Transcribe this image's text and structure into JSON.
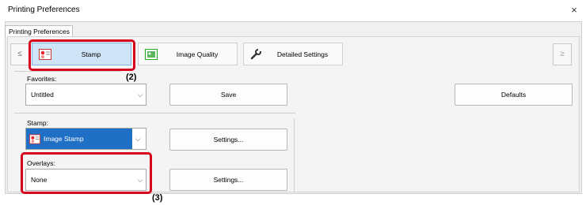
{
  "window": {
    "title": "Printing Preferences",
    "close_glyph": "×"
  },
  "tab": {
    "label": "Printing Preferences"
  },
  "nav": {
    "prev": "≤",
    "next": "≥"
  },
  "top_tabs": [
    {
      "label": "Stamp",
      "icon": "stamp-icon"
    },
    {
      "label": "Image Quality",
      "icon": "image-quality-icon"
    },
    {
      "label": "Detailed Settings",
      "icon": "wrench-icon"
    }
  ],
  "favorites": {
    "label": "Favorites:",
    "value": "Untitled",
    "save": "Save",
    "defaults": "Defaults"
  },
  "stamp": {
    "label": "Stamp:",
    "value": "Image Stamp",
    "settings": "Settings..."
  },
  "overlays": {
    "label": "Overlays:",
    "value": "None",
    "settings": "Settings..."
  },
  "callouts": {
    "two": "(2)",
    "three": "(3)"
  },
  "colors": {
    "highlight": "#d7001b",
    "selected": "#1f6fc5"
  }
}
